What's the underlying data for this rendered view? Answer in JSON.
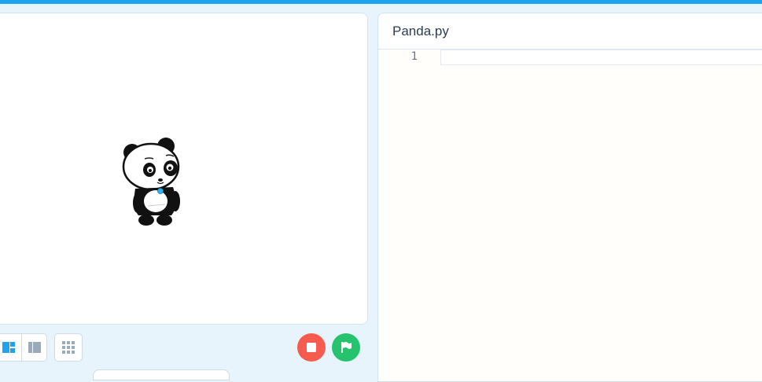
{
  "editor": {
    "filename": "Panda.py",
    "line_numbers": [
      "1"
    ]
  },
  "stage": {
    "sprite": "panda-sprite"
  },
  "controls": {
    "layout_buttons": [
      "layout-small-stage-icon",
      "layout-large-stage-icon"
    ],
    "grid_button": "grid-icon",
    "stop_button": "stop-icon",
    "go_button": "green-flag-icon"
  },
  "colors": {
    "accent": "#1ea3f0",
    "stop": "#f55b4f",
    "go": "#25c36e",
    "active_layout": "#1ea3f0",
    "inactive_icon": "#9aaabb"
  }
}
